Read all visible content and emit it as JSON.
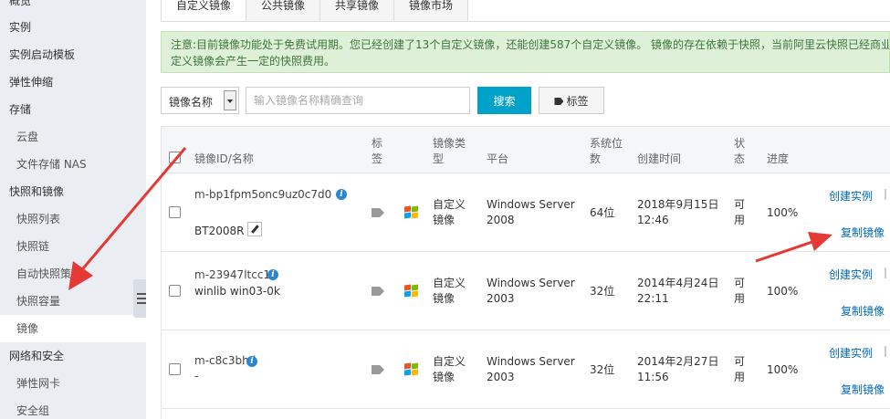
{
  "sidebar": {
    "items": [
      {
        "label": "概览",
        "level": 1
      },
      {
        "label": "实例",
        "level": 1
      },
      {
        "label": "实例启动模板",
        "level": 1
      },
      {
        "label": "弹性伸缩",
        "level": 1
      },
      {
        "label": "存储",
        "level": 1
      },
      {
        "label": "云盘",
        "level": 2
      },
      {
        "label": "文件存储 NAS",
        "level": 2
      },
      {
        "label": "快照和镜像",
        "level": 1
      },
      {
        "label": "快照列表",
        "level": 2
      },
      {
        "label": "快照链",
        "level": 2
      },
      {
        "label": "自动快照策略",
        "level": 2
      },
      {
        "label": "快照容量",
        "level": 2
      },
      {
        "label": "镜像",
        "level": 2,
        "active": true
      },
      {
        "label": "网络和安全",
        "level": 1
      },
      {
        "label": "弹性网卡",
        "level": 2
      },
      {
        "label": "安全组",
        "level": 2
      }
    ]
  },
  "tabs": [
    {
      "label": "自定义镜像",
      "active": true
    },
    {
      "label": "公共镜像"
    },
    {
      "label": "共享镜像"
    },
    {
      "label": "镜像市场"
    }
  ],
  "notice": {
    "line1": "注意:目前镜像功能处于免费试用期。您已经创建了13个自定义镜像，还能创建587个自定义镜像。 镜像的存在依赖于快照，当前阿里云快照已经商业",
    "line2": "定义镜像会产生一定的快照费用。"
  },
  "filter": {
    "select_label": "镜像名称",
    "search_placeholder": "输入镜像名称精确查询",
    "search_button": "搜索",
    "tag_button": "标签"
  },
  "table": {
    "headers": {
      "id_name": "镜像ID/名称",
      "tag_1": "标",
      "tag_2": "签",
      "type_1": "镜像类",
      "type_2": "型",
      "platform": "平台",
      "bits_1": "系统位",
      "bits_2": "数",
      "created": "创建时间",
      "status_1": "状",
      "status_2": "态",
      "progress": "进度"
    },
    "rows": [
      {
        "id": "m-bp1fpm5onc9uz0c7d0",
        "name": "BT2008R",
        "type_1": "自定义",
        "type_2": "镜像",
        "platform_1": "Windows Server",
        "platform_2": "2008",
        "bits": "64位",
        "created_1": "2018年9月15日",
        "created_2": "12:46",
        "status_1": "可",
        "status_2": "用",
        "progress": "100%",
        "action_create": "创建实例",
        "action_copy": "复制镜像"
      },
      {
        "id": "m-23947ltcc1",
        "name": "winlib win03-0k",
        "type_1": "自定义",
        "type_2": "镜像",
        "platform_1": "Windows Server",
        "platform_2": "2003",
        "bits": "32位",
        "created_1": "2014年4月24日",
        "created_2": "22:11",
        "status_1": "可",
        "status_2": "用",
        "progress": "100%",
        "action_create": "创建实例",
        "action_copy": "复制镜像"
      },
      {
        "id": "m-c8c3bhd",
        "name": "-",
        "type_1": "自定义",
        "type_2": "镜像",
        "platform_1": "Windows Server",
        "platform_2": "2003",
        "bits": "32位",
        "created_1": "2014年2月27日",
        "created_2": "11:56",
        "status_1": "可",
        "status_2": "用",
        "progress": "100%",
        "action_create": "创建实例",
        "action_copy": "复制镜像"
      }
    ]
  },
  "colors": {
    "sidebar_bg": "#eaedf1",
    "accent": "#00a2ca",
    "link": "#0068b7",
    "notice_bg": "#dff0d8",
    "annotation_arrow": "#e53935"
  }
}
